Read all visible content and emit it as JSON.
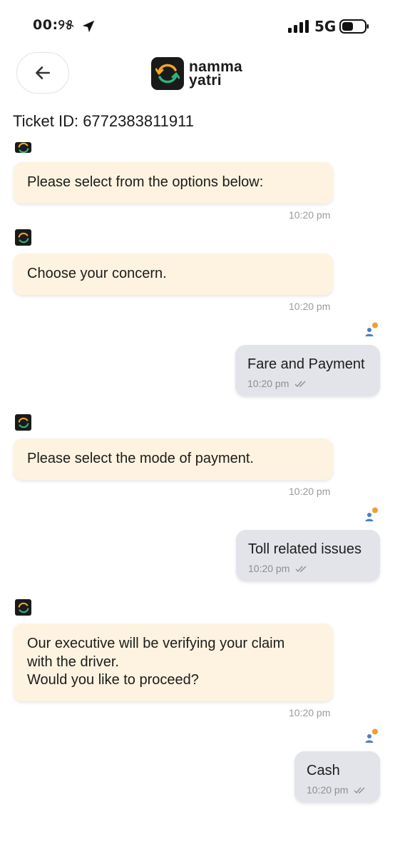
{
  "status_bar": {
    "time": "00:୨୫",
    "network": "5G",
    "icons": [
      "location-arrow-icon",
      "signal-icon",
      "battery-icon"
    ]
  },
  "header": {
    "back_icon": "arrow-left-icon",
    "brand_line1": "namma",
    "brand_line2": "yatri"
  },
  "ticket": {
    "label": "Ticket ID: 6772383811911"
  },
  "messages": [
    {
      "sender": "bot",
      "text": [
        "Please select from the options below:"
      ],
      "time": "10:20 pm"
    },
    {
      "sender": "bot",
      "text": [
        "Choose your concern."
      ],
      "time": "10:20 pm"
    },
    {
      "sender": "user",
      "text": "Fare and Payment",
      "time": "10:20 pm",
      "status": "delivered-check-icon"
    },
    {
      "sender": "bot",
      "text": [
        "Please select the mode of payment."
      ],
      "time": "10:20 pm"
    },
    {
      "sender": "user",
      "text": "Toll related issues",
      "time": "10:20 pm",
      "status": "delivered-check-icon"
    },
    {
      "sender": "bot",
      "text": [
        "Our executive will be verifying your claim",
        "with the driver.",
        "Would you like to proceed?"
      ],
      "time": "10:20 pm"
    },
    {
      "sender": "user",
      "text": "Cash",
      "time": "10:20 pm",
      "status": "delivered-check-icon"
    }
  ],
  "colors": {
    "bot_bubble": "#fdf3e0",
    "user_bubble": "#e2e4e9",
    "logo_orange": "#f5a623",
    "logo_green": "#2fb37c",
    "user_badge": "#f0a030",
    "user_icon": "#4a80c0"
  }
}
